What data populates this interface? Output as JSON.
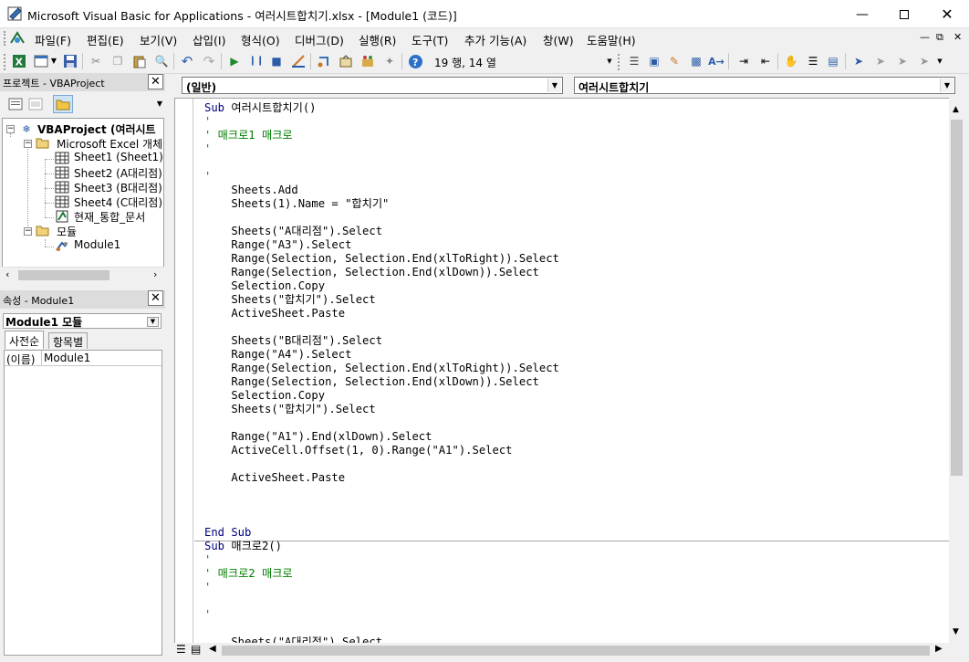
{
  "window": {
    "title": "Microsoft Visual Basic for Applications - 여러시트합치기.xlsx - [Module1 (코드)]",
    "minimize_icon": "minimize-icon",
    "maximize_icon": "maximize-icon",
    "close_icon": "close-icon"
  },
  "menubar": {
    "items": [
      "파일(F)",
      "편집(E)",
      "보기(V)",
      "삽입(I)",
      "형식(O)",
      "디버그(D)",
      "실행(R)",
      "도구(T)",
      "추가 기능(A)",
      "창(W)",
      "도움말(H)"
    ]
  },
  "toolbar": {
    "position_text": "19 행, 14 열"
  },
  "project_pane": {
    "title": "프로젝트 - VBAProject",
    "tree": {
      "root": "VBAProject (여러시트",
      "excel_objects_folder": "Microsoft Excel 개체",
      "sheets": [
        "Sheet1 (Sheet1)",
        "Sheet2 (A대리점)",
        "Sheet3 (B대리점)",
        "Sheet4 (C대리점)"
      ],
      "workbook": "현재_통합_문서",
      "modules_folder": "모듈",
      "module": "Module1"
    }
  },
  "properties_pane": {
    "title": "속성 - Module1",
    "object_combo": "Module1 모듈",
    "tabs": [
      "사전순",
      "항목별"
    ],
    "row_name": "(이름)",
    "row_value": "Module1"
  },
  "code_window": {
    "object_combo": "(일반)",
    "procedure_combo": "여러시트합치기",
    "lines": [
      {
        "kw": "Sub",
        "rest": " 여러시트합치기()"
      },
      {
        "cm": "'"
      },
      {
        "cm": "' 매크로1 매크로"
      },
      {
        "cm": "'"
      },
      {
        "text": ""
      },
      {
        "cm": "'"
      },
      {
        "text": "    Sheets.Add"
      },
      {
        "text": "    Sheets(1).Name = \"합치기\""
      },
      {
        "text": ""
      },
      {
        "text": "    Sheets(\"A대리점\").Select"
      },
      {
        "text": "    Range(\"A3\").Select"
      },
      {
        "text": "    Range(Selection, Selection.End(xlToRight)).Select"
      },
      {
        "text": "    Range(Selection, Selection.End(xlDown)).Select"
      },
      {
        "text": "    Selection.Copy"
      },
      {
        "text": "    Sheets(\"합치기\").Select"
      },
      {
        "text": "    ActiveSheet.Paste"
      },
      {
        "text": ""
      },
      {
        "text": "    Sheets(\"B대리점\").Select"
      },
      {
        "text": "    Range(\"A4\").Select"
      },
      {
        "text": "    Range(Selection, Selection.End(xlToRight)).Select"
      },
      {
        "text": "    Range(Selection, Selection.End(xlDown)).Select"
      },
      {
        "text": "    Selection.Copy"
      },
      {
        "text": "    Sheets(\"합치기\").Select"
      },
      {
        "text": ""
      },
      {
        "text": "    Range(\"A1\").End(xlDown).Select"
      },
      {
        "text": "    ActiveCell.Offset(1, 0).Range(\"A1\").Select"
      },
      {
        "text": ""
      },
      {
        "text": "    ActiveSheet.Paste"
      },
      {
        "text": ""
      },
      {
        "text": ""
      },
      {
        "text": ""
      },
      {
        "kw": "End Sub"
      },
      {
        "kw": "Sub",
        "rest": " 매크로2()"
      },
      {
        "cm": "'"
      },
      {
        "cm": "' 매크로2 매크로"
      },
      {
        "cm": "'"
      },
      {
        "text": ""
      },
      {
        "cm": "'"
      },
      {
        "text": ""
      },
      {
        "text": "    Sheets(\"A대리점\").Select"
      }
    ]
  }
}
